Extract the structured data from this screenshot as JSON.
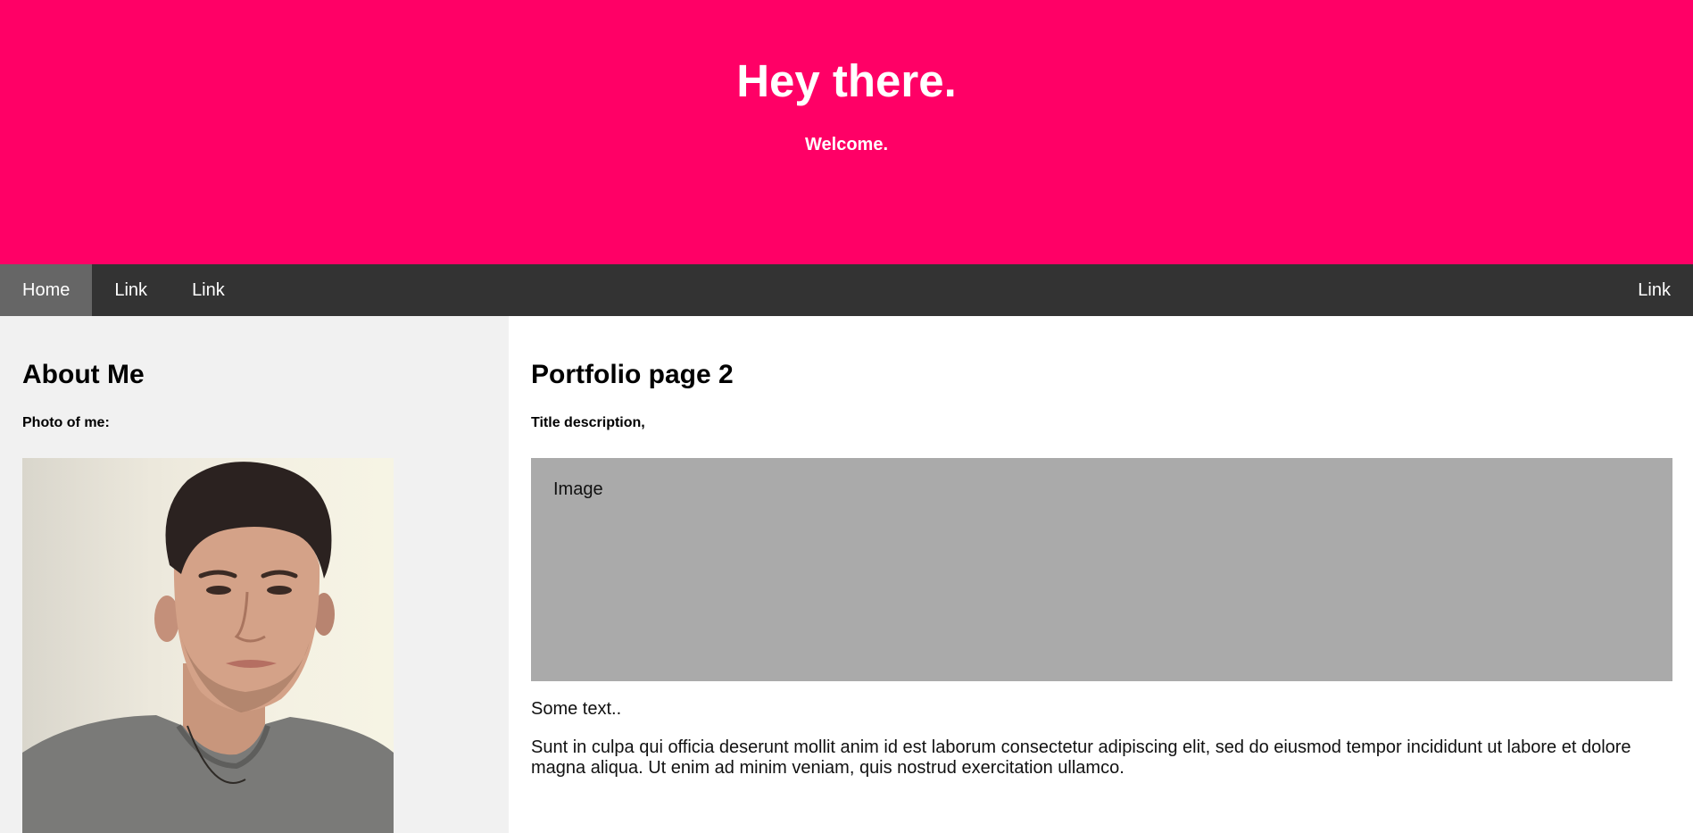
{
  "header": {
    "title": "Hey there.",
    "subtitle": "Welcome."
  },
  "navbar": {
    "items": [
      {
        "label": "Home",
        "active": true
      },
      {
        "label": "Link"
      },
      {
        "label": "Link"
      }
    ],
    "right_item": {
      "label": "Link"
    }
  },
  "side": {
    "heading": "About Me",
    "photo_label": "Photo of me:"
  },
  "main": {
    "heading": "Portfolio page 2",
    "subheading": "Title description,",
    "image_placeholder": "Image",
    "text_short": "Some text..",
    "text_long": "Sunt in culpa qui officia deserunt mollit anim id est laborum consectetur adipiscing elit, sed do eiusmod tempor incididunt ut labore et dolore magna aliqua. Ut enim ad minim veniam, quis nostrud exercitation ullamco."
  },
  "colors": {
    "header_bg": "#ff0066",
    "navbar_bg": "#333333",
    "nav_active_bg": "#666666",
    "side_bg": "#f1f1f1",
    "image_placeholder_bg": "#aaaaaa"
  }
}
